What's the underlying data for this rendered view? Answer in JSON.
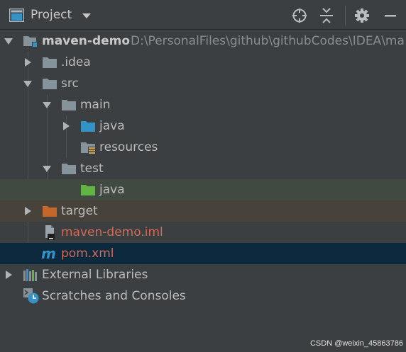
{
  "header": {
    "title": "Project"
  },
  "tree": {
    "root_name": "maven-demo",
    "root_path": "D:\\PersonalFiles\\github\\githubCodes\\IDEA\\ma",
    "idea": ".idea",
    "src": "src",
    "main": "main",
    "main_java": "java",
    "resources": "resources",
    "test": "test",
    "test_java": "java",
    "target": "target",
    "iml": "maven-demo.iml",
    "pom": "pom.xml",
    "external_libraries": "External Libraries",
    "scratches": "Scratches and Consoles"
  },
  "colors": {
    "default_text": "#bbbbbb",
    "excluded_text": "#d16a55",
    "folder_gray": "#87939a",
    "source_folder": "#3592c4",
    "test_folder": "#62b543",
    "excluded_folder": "#c3672b"
  },
  "watermark": "CSDN @weixin_45863786"
}
